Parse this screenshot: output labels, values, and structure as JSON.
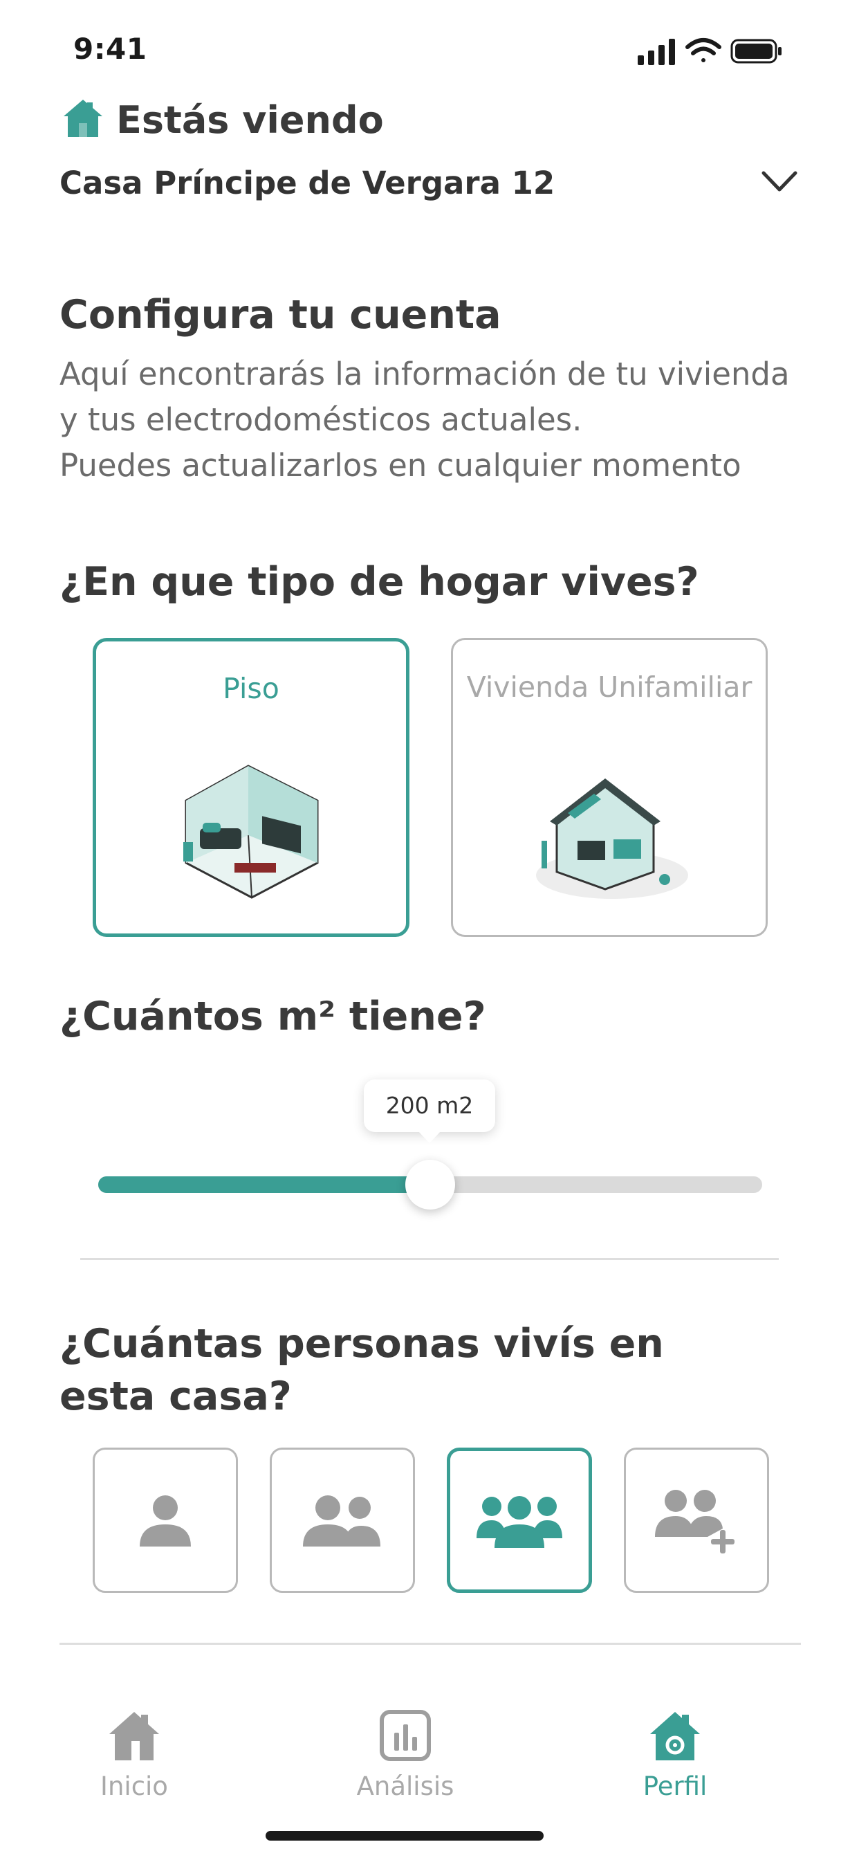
{
  "status_bar": {
    "time": "9:41",
    "icons": [
      "signal-icon",
      "wifi-icon",
      "battery-icon"
    ]
  },
  "header": {
    "title": "Estás viendo",
    "house_name": "Casa Príncipe de Vergara 12",
    "icons": [
      "home-icon",
      "chevron-down-icon"
    ]
  },
  "config": {
    "title": "Configura tu cuenta",
    "description_lines": [
      "Aquí encontrarás la información de tu vivienda",
      "y tus electrodomésticos actuales.",
      "Puedes actualizarlos en cualquier momento"
    ]
  },
  "home_type": {
    "question": "¿En que tipo de hogar vives?",
    "options": [
      {
        "label": "Piso",
        "selected": true
      },
      {
        "label": "Vivienda Unifamiliar",
        "selected": false
      }
    ]
  },
  "area": {
    "question": "¿Cuántos m² tiene?",
    "value_label": "200 m2",
    "fill_fraction": 0.5
  },
  "people": {
    "question_line1": "¿Cuántas personas vivís en",
    "question_line2": "esta casa?",
    "options": [
      {
        "icon": "single-person-icon",
        "selected": false
      },
      {
        "icon": "two-people-icon",
        "selected": false
      },
      {
        "icon": "three-people-icon",
        "selected": true
      },
      {
        "icon": "add-people-icon",
        "selected": false
      }
    ]
  },
  "tabbar": {
    "items": [
      {
        "label": "Inicio",
        "icon": "home-icon",
        "active": false
      },
      {
        "label": "Análisis",
        "icon": "chart-icon",
        "active": false
      },
      {
        "label": "Perfil",
        "icon": "profile-home-icon",
        "active": true
      }
    ]
  },
  "colors": {
    "accent": "#3a9e94",
    "text": "#3a3a3a",
    "muted": "#a9a9a9",
    "border": "#b9b9b9"
  }
}
